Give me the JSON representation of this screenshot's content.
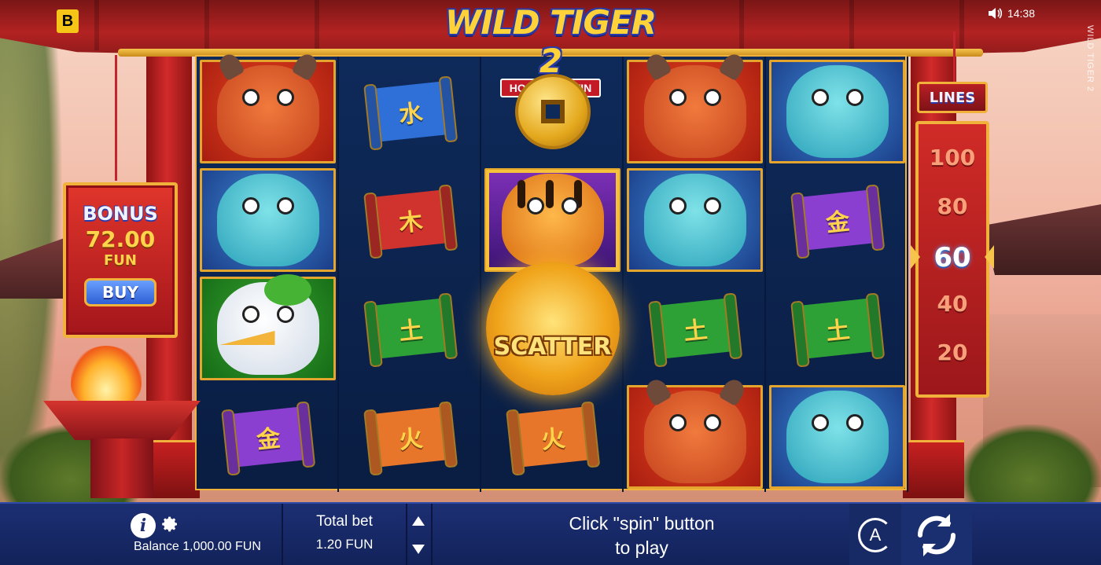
{
  "header": {
    "brand_badge": "B",
    "time": "14:38",
    "vertical_title": "WILD TIGER 2",
    "logo_title": "WILD TIGER 2",
    "logo_subtitle": "HOLD AND WIN"
  },
  "bonus": {
    "title": "BONUS",
    "amount": "72.00",
    "currency": "FUN",
    "buy_label": "BUY"
  },
  "lines": {
    "title": "LINES",
    "options": [
      "100",
      "80",
      "60",
      "40",
      "20"
    ],
    "selected": "60"
  },
  "reels": [
    [
      "bull",
      "frog",
      "crane",
      "scroll-purple"
    ],
    [
      "scroll-blue",
      "scroll-red",
      "scroll-green",
      "scroll-orange"
    ],
    [
      "coin",
      "tiger",
      "scatter",
      "scroll-orange"
    ],
    [
      "bull",
      "frog",
      "scroll-green",
      "bull"
    ],
    [
      "frog",
      "scroll-purple",
      "scroll-green",
      "frog"
    ]
  ],
  "scroll_glyphs": {
    "blue": "水",
    "red": "木",
    "green": "土",
    "orange": "火",
    "purple": "金"
  },
  "scatter_label": "SCATTER",
  "bottom_bar": {
    "balance": "Balance 1,000.00 FUN",
    "total_bet_label": "Total bet",
    "total_bet_value": "1.20 FUN",
    "message_line1": "Click \"spin\" button",
    "message_line2": "to play",
    "auto_label": "A"
  },
  "colors": {
    "bar_bg": "#1c2f73",
    "gold_trim": "#f0b23a",
    "roof_red": "#b32222"
  }
}
